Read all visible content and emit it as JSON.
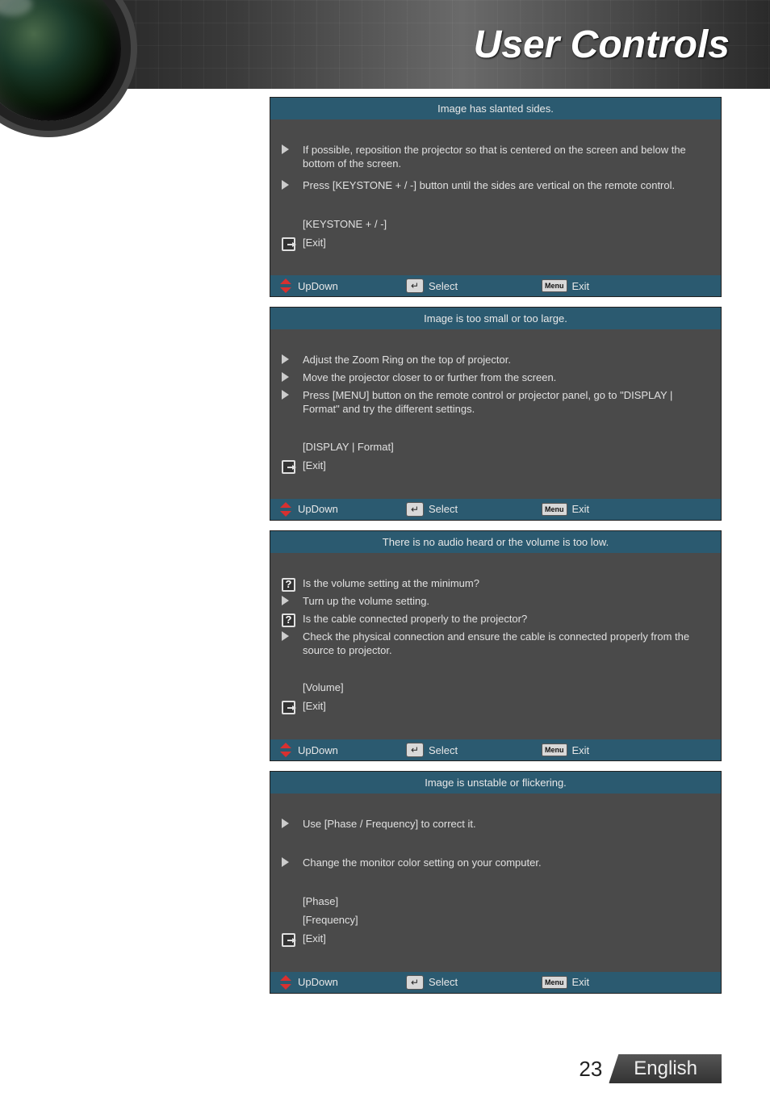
{
  "header": {
    "title": "User Controls"
  },
  "panels": [
    {
      "title": "Image has slanted sides.",
      "steps": [
        {
          "icon": "arrow",
          "text": "If possible, reposition the projector so that is centered on the screen and below the bottom of the screen."
        },
        {
          "icon": "arrow",
          "text": "Press [KEYSTONE + / -] button until the sides are vertical on the remote control."
        }
      ],
      "brackets": [
        {
          "icon": "none",
          "text": "[KEYSTONE + / -]"
        },
        {
          "icon": "exit",
          "text": "[Exit]"
        }
      ]
    },
    {
      "title": "Image is too small or too large.",
      "steps": [
        {
          "icon": "arrow",
          "text": "Adjust the Zoom Ring on the top of projector."
        },
        {
          "icon": "arrow",
          "text": "Move the projector closer to or further from the screen."
        },
        {
          "icon": "arrow",
          "text": "Press [MENU] button on the remote control or projector panel, go to \"DISPLAY | Format\" and try the different settings."
        }
      ],
      "brackets": [
        {
          "icon": "none",
          "text": "[DISPLAY | Format]"
        },
        {
          "icon": "exit",
          "text": "[Exit]"
        }
      ]
    },
    {
      "title": "There is no audio heard or the volume is too low.",
      "steps": [
        {
          "icon": "question",
          "text": "Is the volume setting at the minimum?"
        },
        {
          "icon": "arrow",
          "text": "Turn up the volume setting."
        },
        {
          "icon": "question",
          "text": "Is the cable connected properly to the projector?"
        },
        {
          "icon": "arrow",
          "text": "Check the physical connection and ensure the cable is connected properly from the source to projector."
        }
      ],
      "brackets": [
        {
          "icon": "none",
          "text": "[Volume]"
        },
        {
          "icon": "exit",
          "text": "[Exit]"
        }
      ]
    },
    {
      "title": "Image is unstable or flickering.",
      "steps": [
        {
          "icon": "arrow",
          "text": "Use [Phase / Frequency] to correct it."
        },
        {
          "icon": "arrow",
          "text": "Change the monitor color setting on your computer."
        }
      ],
      "brackets": [
        {
          "icon": "none",
          "text": "[Phase]"
        },
        {
          "icon": "none",
          "text": "[Frequency]"
        },
        {
          "icon": "exit",
          "text": "[Exit]"
        }
      ],
      "spaced": true
    }
  ],
  "keys": {
    "updown": "UpDown",
    "select": "Select",
    "menu": "Menu",
    "exit": "Exit"
  },
  "footer": {
    "page": "23",
    "language": "English"
  }
}
